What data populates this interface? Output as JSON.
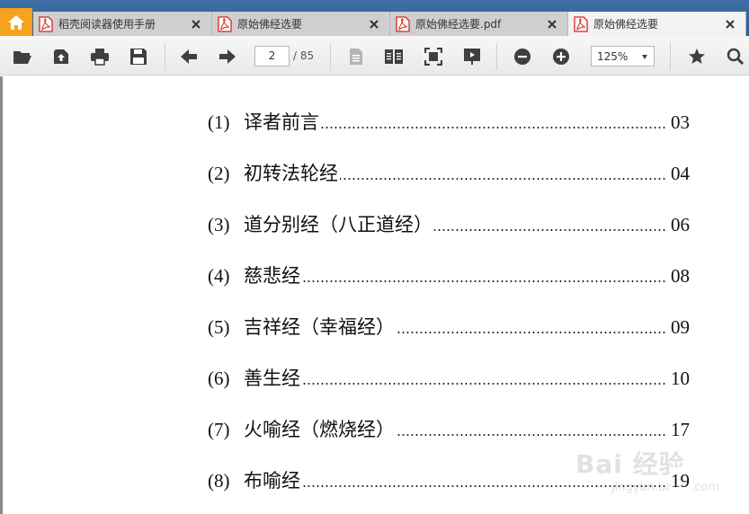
{
  "tabs": [
    {
      "label": "稻壳阅读器使用手册",
      "active": false
    },
    {
      "label": "原始佛经选要",
      "active": false
    },
    {
      "label": "原始佛经选要.pdf",
      "active": false
    },
    {
      "label": "原始佛经选要",
      "active": true
    }
  ],
  "toolbar": {
    "page_current": "2",
    "page_total": "/ 85",
    "zoom": "125%"
  },
  "toc": [
    {
      "num": "(1)",
      "title": "译者前言",
      "page": "03"
    },
    {
      "num": "(2)",
      "title": "初转法轮经",
      "page": "04"
    },
    {
      "num": "(3)",
      "title": "道分别经（八正道经）",
      "page": "06"
    },
    {
      "num": "(4)",
      "title": "慈悲经",
      "page": "08"
    },
    {
      "num": "(5)",
      "title": "吉祥经（幸福经）",
      "page": "09"
    },
    {
      "num": "(6)",
      "title": "善生经",
      "page": "10"
    },
    {
      "num": "(7)",
      "title": "火喻经（燃烧经）",
      "page": "17"
    },
    {
      "num": "(8)",
      "title": "布喻经",
      "page": "19"
    }
  ],
  "watermark": {
    "main": "Bai 经验",
    "sub": "jingyan.baidu.com"
  },
  "colors": {
    "home": "#f5a21d",
    "tabbar": "#2d5d93",
    "pdf_icon": "#d8261c"
  }
}
